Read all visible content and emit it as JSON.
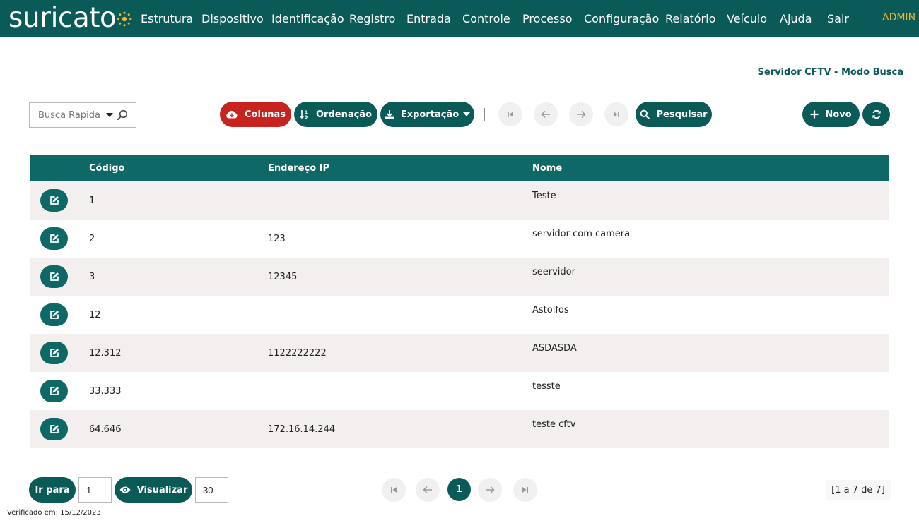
{
  "app": {
    "logo_text": "suricato",
    "nav": [
      "Estrutura",
      "Dispositivo",
      "Identificação",
      "Registro",
      "Entrada",
      "Controle",
      "Processo",
      "Configuração",
      "Relatório",
      "Veículo",
      "Ajuda",
      "Sair"
    ],
    "user": "ADMIN",
    "accent_color": "#0a5a58",
    "danger_color": "#c9231f",
    "user_color": "#f1b52b"
  },
  "page": {
    "title": "Servidor CFTV - Modo Busca"
  },
  "toolbar": {
    "quick_search_placeholder": "Busca Rapida",
    "columns_label": "Colunas",
    "ordering_label": "Ordenação",
    "export_label": "Exportação",
    "search_label": "Pesquisar",
    "new_label": "Novo"
  },
  "table": {
    "headers": {
      "code": "Código",
      "ip": "Endereço IP",
      "name": "Nome"
    },
    "rows": [
      {
        "code": "1",
        "ip": "",
        "name": "Teste"
      },
      {
        "code": "2",
        "ip": "123",
        "name": "servidor com camera"
      },
      {
        "code": "3",
        "ip": "12345",
        "name": "seervidor"
      },
      {
        "code": "12",
        "ip": "",
        "name": "Astolfos"
      },
      {
        "code": "12.312",
        "ip": "1122222222",
        "name": "ASDASDA"
      },
      {
        "code": "33.333",
        "ip": "",
        "name": "tesste"
      },
      {
        "code": "64.646",
        "ip": "172.16.14.244",
        "name": "teste cftv"
      }
    ]
  },
  "footer": {
    "goto_label": "Ir para",
    "goto_value": "1",
    "view_label": "Visualizar",
    "per_page_value": "30",
    "current_page": "1",
    "range_text": "[1 a 7 de 7]",
    "verified_text": "Verificado em: 15/12/2023"
  }
}
